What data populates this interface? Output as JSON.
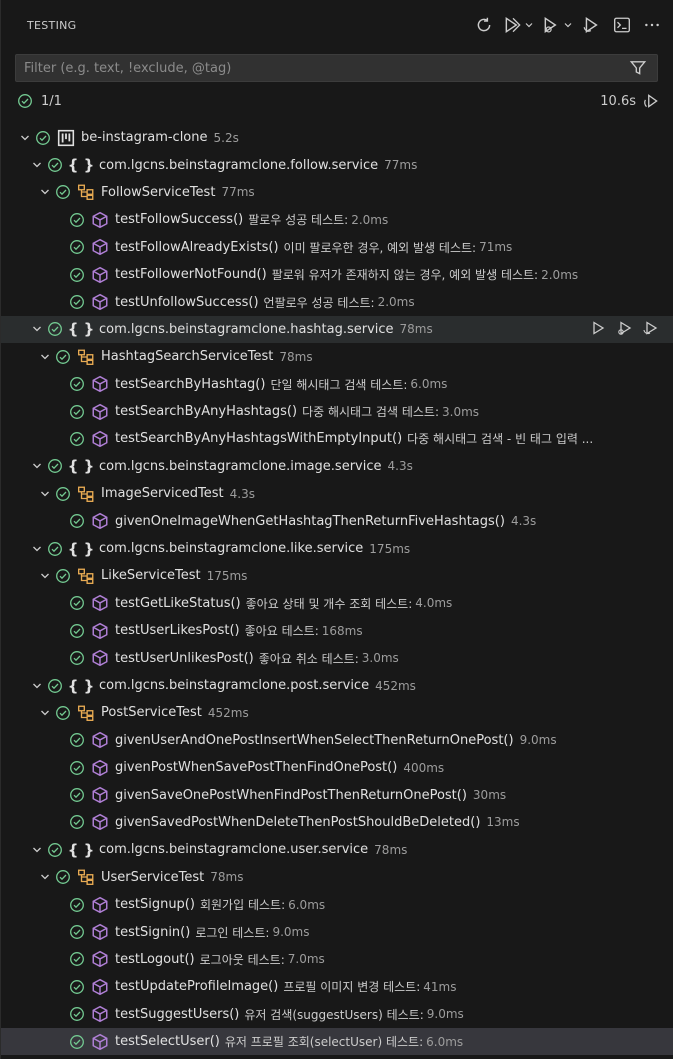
{
  "header": {
    "title": "TESTING"
  },
  "filter": {
    "placeholder": "Filter (e.g. text, !exclude, @tag)"
  },
  "summary": {
    "count": "1/1",
    "duration": "10.6s"
  },
  "colors": {
    "pass": "#73c991",
    "cube": "#b180d7",
    "class": "#e8ab53",
    "project": "#e0e0e0"
  },
  "tree": [
    {
      "level": 0,
      "kind": "project",
      "name": "be-instagram-clone",
      "desc": "",
      "dur": "5.2s"
    },
    {
      "level": 1,
      "kind": "package",
      "name": "com.lgcns.beinstagramclone.follow.service",
      "desc": "",
      "dur": "77ms"
    },
    {
      "level": 2,
      "kind": "class",
      "name": "FollowServiceTest",
      "desc": "",
      "dur": "77ms"
    },
    {
      "level": 3,
      "kind": "method",
      "name": "testFollowSuccess()",
      "desc": "팔로우 성공 테스트:",
      "dur": "2.0ms"
    },
    {
      "level": 3,
      "kind": "method",
      "name": "testFollowAlreadyExists()",
      "desc": "이미 팔로우한 경우, 예외 발생 테스트:",
      "dur": "71ms"
    },
    {
      "level": 3,
      "kind": "method",
      "name": "testFollowerNotFound()",
      "desc": "팔로워 유저가 존재하지 않는 경우, 예외 발생 테스트:",
      "dur": "2.0ms"
    },
    {
      "level": 3,
      "kind": "method",
      "name": "testUnfollowSuccess()",
      "desc": "언팔로우 성공 테스트:",
      "dur": "2.0ms"
    },
    {
      "level": 1,
      "kind": "package",
      "name": "com.lgcns.beinstagramclone.hashtag.service",
      "desc": "",
      "dur": "78ms",
      "hover": true
    },
    {
      "level": 2,
      "kind": "class",
      "name": "HashtagSearchServiceTest",
      "desc": "",
      "dur": "78ms"
    },
    {
      "level": 3,
      "kind": "method",
      "name": "testSearchByHashtag()",
      "desc": "단일 해시태그 검색 테스트:",
      "dur": "6.0ms"
    },
    {
      "level": 3,
      "kind": "method",
      "name": "testSearchByAnyHashtags()",
      "desc": "다중 해시태그 검색 테스트:",
      "dur": "3.0ms"
    },
    {
      "level": 3,
      "kind": "method",
      "name": "testSearchByAnyHashtagsWithEmptyInput()",
      "desc": "다중 해시태그 검색 - 빈 태그 입력 ...",
      "dur": ""
    },
    {
      "level": 1,
      "kind": "package",
      "name": "com.lgcns.beinstagramclone.image.service",
      "desc": "",
      "dur": "4.3s"
    },
    {
      "level": 2,
      "kind": "class",
      "name": "ImageServicedTest",
      "desc": "",
      "dur": "4.3s"
    },
    {
      "level": 3,
      "kind": "method",
      "name": "givenOneImageWhenGetHashtagThenReturnFiveHashtags()",
      "desc": "",
      "dur": "4.3s"
    },
    {
      "level": 1,
      "kind": "package",
      "name": "com.lgcns.beinstagramclone.like.service",
      "desc": "",
      "dur": "175ms"
    },
    {
      "level": 2,
      "kind": "class",
      "name": "LikeServiceTest",
      "desc": "",
      "dur": "175ms"
    },
    {
      "level": 3,
      "kind": "method",
      "name": "testGetLikeStatus()",
      "desc": "좋아요 상태 및 개수 조회 테스트:",
      "dur": "4.0ms"
    },
    {
      "level": 3,
      "kind": "method",
      "name": "testUserLikesPost()",
      "desc": "좋아요 테스트:",
      "dur": "168ms"
    },
    {
      "level": 3,
      "kind": "method",
      "name": "testUserUnlikesPost()",
      "desc": "좋아요 취소 테스트:",
      "dur": "3.0ms"
    },
    {
      "level": 1,
      "kind": "package",
      "name": "com.lgcns.beinstagramclone.post.service",
      "desc": "",
      "dur": "452ms"
    },
    {
      "level": 2,
      "kind": "class",
      "name": "PostServiceTest",
      "desc": "",
      "dur": "452ms"
    },
    {
      "level": 3,
      "kind": "method",
      "name": "givenUserAndOnePostInsertWhenSelectThenReturnOnePost()",
      "desc": "",
      "dur": "9.0ms"
    },
    {
      "level": 3,
      "kind": "method",
      "name": "givenPostWhenSavePostThenFindOnePost()",
      "desc": "",
      "dur": "400ms"
    },
    {
      "level": 3,
      "kind": "method",
      "name": "givenSaveOnePostWhenFindPostThenReturnOnePost()",
      "desc": "",
      "dur": "30ms"
    },
    {
      "level": 3,
      "kind": "method",
      "name": "givenSavedPostWhenDeleteThenPostShouldBeDeleted()",
      "desc": "",
      "dur": "13ms"
    },
    {
      "level": 1,
      "kind": "package",
      "name": "com.lgcns.beinstagramclone.user.service",
      "desc": "",
      "dur": "78ms"
    },
    {
      "level": 2,
      "kind": "class",
      "name": "UserServiceTest",
      "desc": "",
      "dur": "78ms"
    },
    {
      "level": 3,
      "kind": "method",
      "name": "testSignup()",
      "desc": "회원가입 테스트:",
      "dur": "6.0ms"
    },
    {
      "level": 3,
      "kind": "method",
      "name": "testSignin()",
      "desc": "로그인 테스트:",
      "dur": "9.0ms"
    },
    {
      "level": 3,
      "kind": "method",
      "name": "testLogout()",
      "desc": "로그아웃 테스트:",
      "dur": "7.0ms"
    },
    {
      "level": 3,
      "kind": "method",
      "name": "testUpdateProfileImage()",
      "desc": "프로필 이미지 변경 테스트:",
      "dur": "41ms"
    },
    {
      "level": 3,
      "kind": "method",
      "name": "testSuggestUsers()",
      "desc": "유저 검색(suggestUsers) 테스트:",
      "dur": "9.0ms"
    },
    {
      "level": 3,
      "kind": "method",
      "name": "testSelectUser()",
      "desc": "유저 프로필 조회(selectUser) 테스트:",
      "dur": "6.0ms",
      "selected": true
    }
  ]
}
